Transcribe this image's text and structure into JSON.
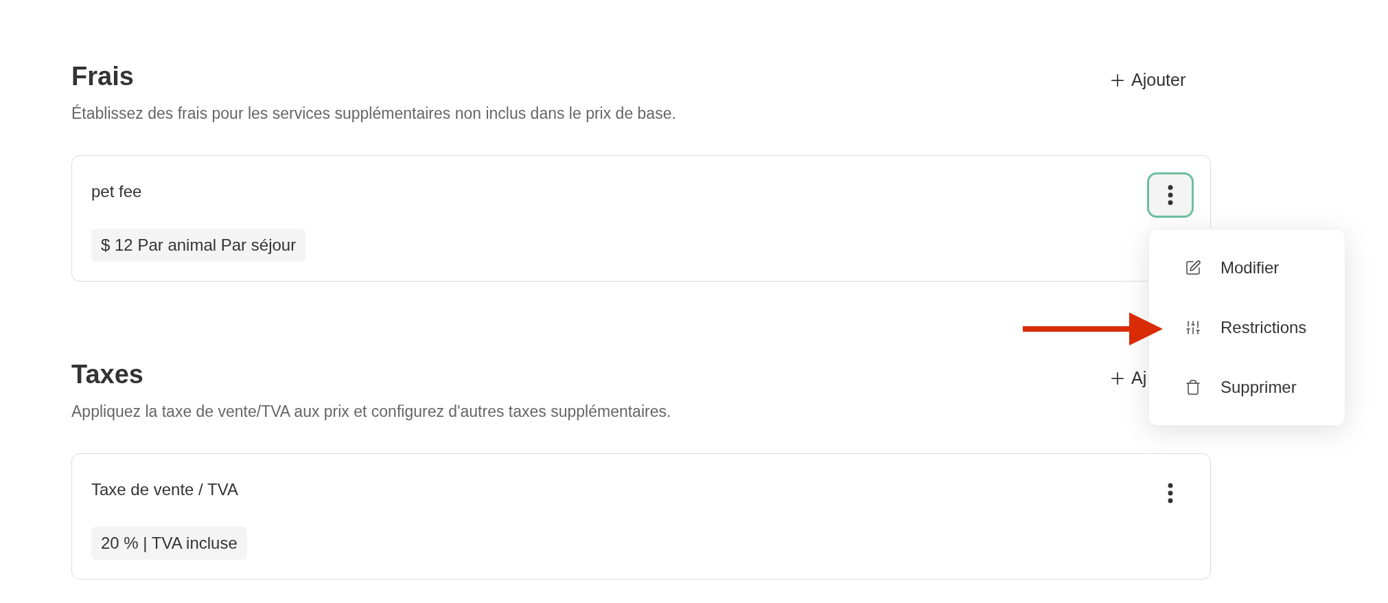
{
  "sections": [
    {
      "title": "Frais",
      "add_button": "Ajouter",
      "description": "Établissez des frais pour les services supplémentaires non inclus dans le prix de base.",
      "items": [
        {
          "name": "pet fee",
          "badge": "$ 12 Par animal Par séjour",
          "menu_open": true
        }
      ]
    },
    {
      "title": "Taxes",
      "add_button": "Aj",
      "description": "Appliquez la taxe de vente/TVA aux prix et configurez d'autres taxes supplémentaires.",
      "items": [
        {
          "name": "Taxe de vente / TVA",
          "badge": "20 % | TVA incluse",
          "menu_open": false
        }
      ]
    }
  ],
  "menu": {
    "items": [
      {
        "kind": "edit",
        "label": "Modifier"
      },
      {
        "kind": "sliders",
        "label": "Restrictions"
      },
      {
        "kind": "trash",
        "label": "Supprimer"
      }
    ]
  },
  "annotation": {
    "kind": "arrow",
    "color": "#d92b06"
  }
}
